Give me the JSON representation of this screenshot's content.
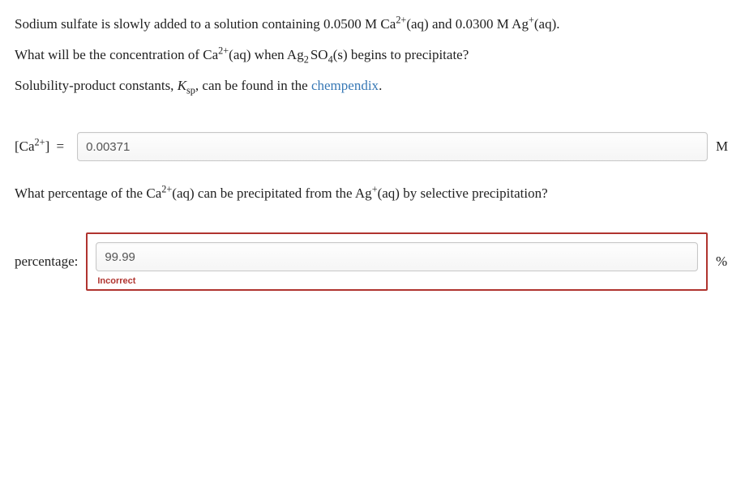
{
  "question": {
    "line1_pre": "Sodium sulfate is slowly added to a solution containing 0.0500 M Ca",
    "line1_sp1_sup": "2+",
    "line1_mid": "(aq) and 0.0300 M Ag",
    "line1_sp2_sup": "+",
    "line1_post": "(aq).",
    "line2_pre": "What will be the concentration of Ca",
    "line2_sp_sup": "2+",
    "line2_mid": "(aq) when Ag",
    "line2_sub": "2",
    "line2_so4_o": "SO",
    "line2_so4_sub": "4",
    "line2_post": "(s) begins to precipitate?",
    "line3_pre": "Solubility-product constants, ",
    "line3_k": "K",
    "line3_ksub": "sp",
    "line3_mid": ", can be found in the ",
    "link": "chempendix",
    "line3_post": "."
  },
  "answer1": {
    "label_open": "[Ca",
    "label_sup": "2+",
    "label_close": "]",
    "equals": "=",
    "value": "0.00371",
    "unit": "M"
  },
  "question2": {
    "pre": "What percentage of the Ca",
    "sup": "2+",
    "mid": "(aq) can be precipitated from the Ag",
    "sup2": "+",
    "post": "(aq) by selective precipitation?"
  },
  "answer2": {
    "label": "percentage:",
    "value": "99.99",
    "unit": "%",
    "feedback": "Incorrect"
  }
}
